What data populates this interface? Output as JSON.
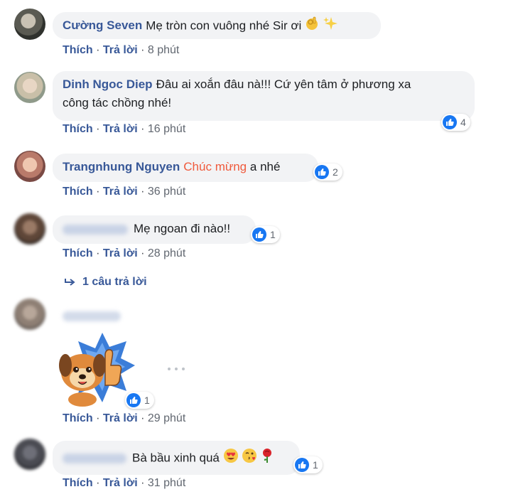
{
  "comments": [
    {
      "author": "Cường Seven",
      "text": "Mẹ tròn con vuông nhé Sir ơi",
      "emojis": [
        "ok-hand-emoji",
        "sparkles-emoji"
      ],
      "like_label": "Thích",
      "reply_label": "Trả lời",
      "separator": "·",
      "time": "8 phút"
    },
    {
      "author": "Dinh Ngoc Diep",
      "text_line1": "Đâu ai xoắn đâu nà!!! Cứ yên tâm ở phương xa",
      "text_line2": "công tác chồng nhé!",
      "reactions": "4",
      "like_label": "Thích",
      "reply_label": "Trả lời",
      "separator": "·",
      "time": "16 phút"
    },
    {
      "author": "Trangnhung Nguyen",
      "text_highlight": "Chúc mừng",
      "text": "a nhé",
      "reactions": "2",
      "like_label": "Thích",
      "reply_label": "Trả lời",
      "separator": "·",
      "time": "36 phút"
    },
    {
      "author": "",
      "text": "Mẹ ngoan đi nào!!",
      "reactions": "1",
      "like_label": "Thích",
      "reply_label": "Trả lời",
      "separator": "·",
      "time": "28 phút",
      "replies_link": "1 câu trả lời"
    },
    {
      "author": "",
      "sticker": "puppy-thumbs-up-sticker",
      "reactions": "1",
      "like_label": "Thích",
      "reply_label": "Trả lời",
      "separator": "·",
      "time": "29 phút"
    },
    {
      "author": "",
      "text": "Bà bầu xinh quá",
      "emojis": [
        "heart-eyes-emoji",
        "kissing-face-emoji",
        "rose-emoji"
      ],
      "reactions": "1",
      "like_label": "Thích",
      "reply_label": "Trả lời",
      "separator": "·",
      "time": "31 phút"
    }
  ],
  "colors": {
    "link": "#385898",
    "bubble": "#f2f3f5",
    "highlight": "#f05a3c",
    "like": "#1877f2"
  }
}
